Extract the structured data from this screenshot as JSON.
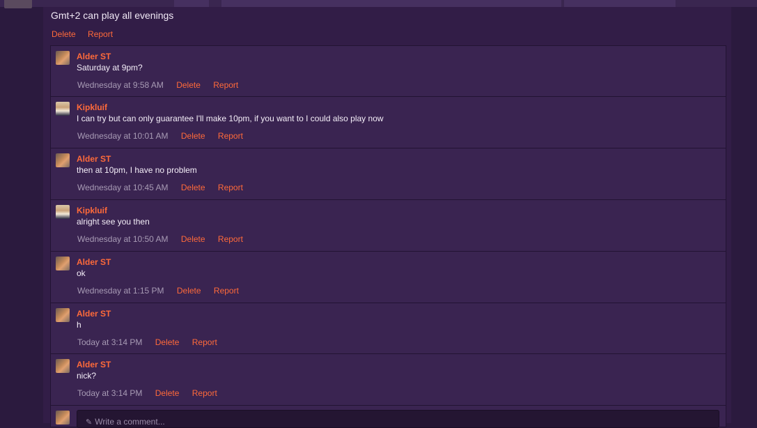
{
  "post": {
    "text": "Gmt+2 can play all evenings",
    "delete_label": "Delete",
    "report_label": "Report"
  },
  "comments": [
    {
      "author": "Alder ST",
      "avatar": "alder-avatar",
      "text": "Saturday at 9pm?",
      "time": "Wednesday at 9:58 AM",
      "delete": "Delete",
      "report": "Report"
    },
    {
      "author": "Kipkluif",
      "avatar": "kipkluif-avatar",
      "text": "I can try but can only guarantee I'll make 10pm, if you want to I could also play now",
      "time": "Wednesday at 10:01 AM",
      "delete": "Delete",
      "report": "Report"
    },
    {
      "author": "Alder ST",
      "avatar": "alder-avatar",
      "text": "then at 10pm, I have no problem",
      "time": "Wednesday at 10:45 AM",
      "delete": "Delete",
      "report": "Report"
    },
    {
      "author": "Kipkluif",
      "avatar": "kipkluif-avatar",
      "text": "alright see you then",
      "time": "Wednesday at 10:50 AM",
      "delete": "Delete",
      "report": "Report"
    },
    {
      "author": "Alder ST",
      "avatar": "alder-avatar",
      "text": "ok",
      "time": "Wednesday at 1:15 PM",
      "delete": "Delete",
      "report": "Report"
    },
    {
      "author": "Alder ST",
      "avatar": "alder-avatar",
      "text": "h",
      "time": "Today at 3:14 PM",
      "delete": "Delete",
      "report": "Report"
    },
    {
      "author": "Alder ST",
      "avatar": "alder-avatar",
      "text": "nick?",
      "time": "Today at 3:14 PM",
      "delete": "Delete",
      "report": "Report"
    }
  ],
  "comment_box": {
    "placeholder": "Write a comment..."
  },
  "colors": {
    "accent": "#ff6a3a",
    "background": "#2b1a3e",
    "panel": "#321d47"
  }
}
